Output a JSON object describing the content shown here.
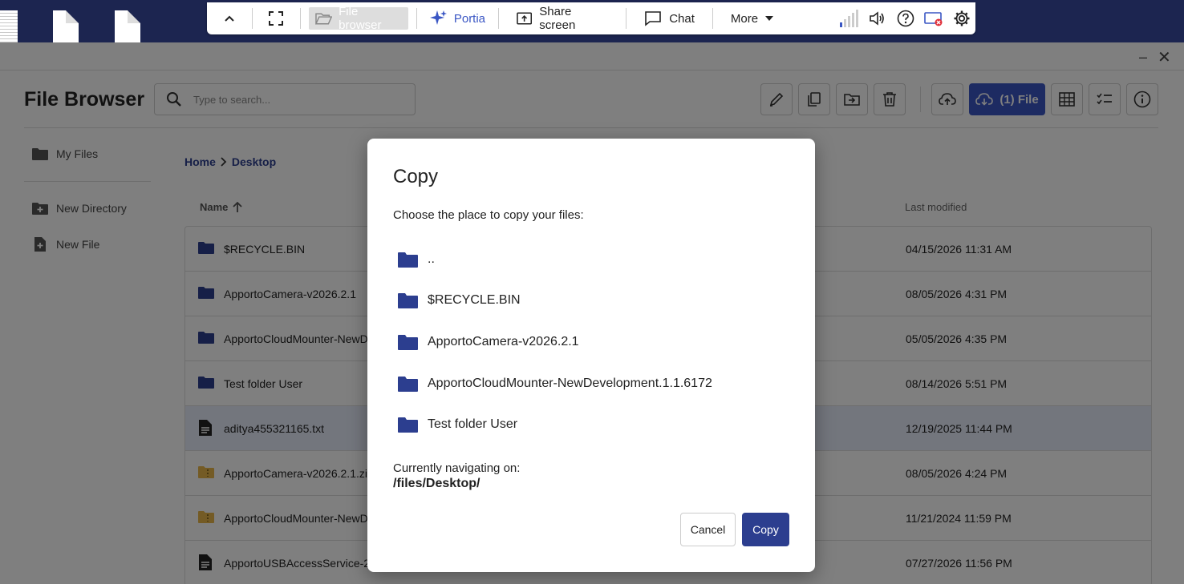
{
  "toolbar": {
    "file_browser": "File browser",
    "portia": "Portia",
    "share_screen": "Share screen",
    "chat": "Chat",
    "more": "More"
  },
  "app": {
    "title": "File Browser",
    "search_placeholder": "Type to search...",
    "download_button": "(1) File"
  },
  "sidebar": {
    "items": [
      {
        "label": "My Files"
      },
      {
        "label": "New Directory"
      },
      {
        "label": "New File"
      }
    ]
  },
  "breadcrumbs": [
    "Home",
    "Desktop"
  ],
  "columns": {
    "name": "Name",
    "last_modified": "Last modified"
  },
  "files": [
    {
      "name": "$RECYCLE.BIN",
      "date": "04/15/2026 11:31 AM",
      "type": "folder"
    },
    {
      "name": "ApportoCamera-v2026.2.1",
      "date": "08/05/2026 4:31 PM",
      "type": "folder"
    },
    {
      "name": "ApportoCloudMounter-NewD",
      "date": "05/05/2026 4:35 PM",
      "type": "folder"
    },
    {
      "name": "Test folder User",
      "date": "08/14/2026 5:51 PM",
      "type": "folder"
    },
    {
      "name": "aditya455321165.txt",
      "date": "12/19/2025 11:44 PM",
      "type": "file"
    },
    {
      "name": "ApportoCamera-v2026.2.1.zi",
      "date": "08/05/2026 4:24 PM",
      "type": "zip"
    },
    {
      "name": "ApportoCloudMounter-NewD",
      "date": "11/21/2024 11:59 PM",
      "type": "zip"
    },
    {
      "name": "ApportoUSBAccessService-2",
      "date": "07/27/2026 11:56 PM",
      "type": "file"
    }
  ],
  "dialog": {
    "title": "Copy",
    "subtitle": "Choose the place to copy your files:",
    "destinations": [
      "..",
      "$RECYCLE.BIN",
      "ApportoCamera-v2026.2.1",
      "ApportoCloudMounter-NewDevelopment.1.1.6172",
      "Test folder User"
    ],
    "navigating_label": "Currently navigating on:",
    "navigating_path": "/files/Desktop/",
    "cancel": "Cancel",
    "copy": "Copy"
  },
  "colors": {
    "accent": "#3a56c4",
    "primary_dark": "#2c3e8f",
    "folder": "#2c3e8f",
    "zip_folder": "#e8b64a"
  }
}
